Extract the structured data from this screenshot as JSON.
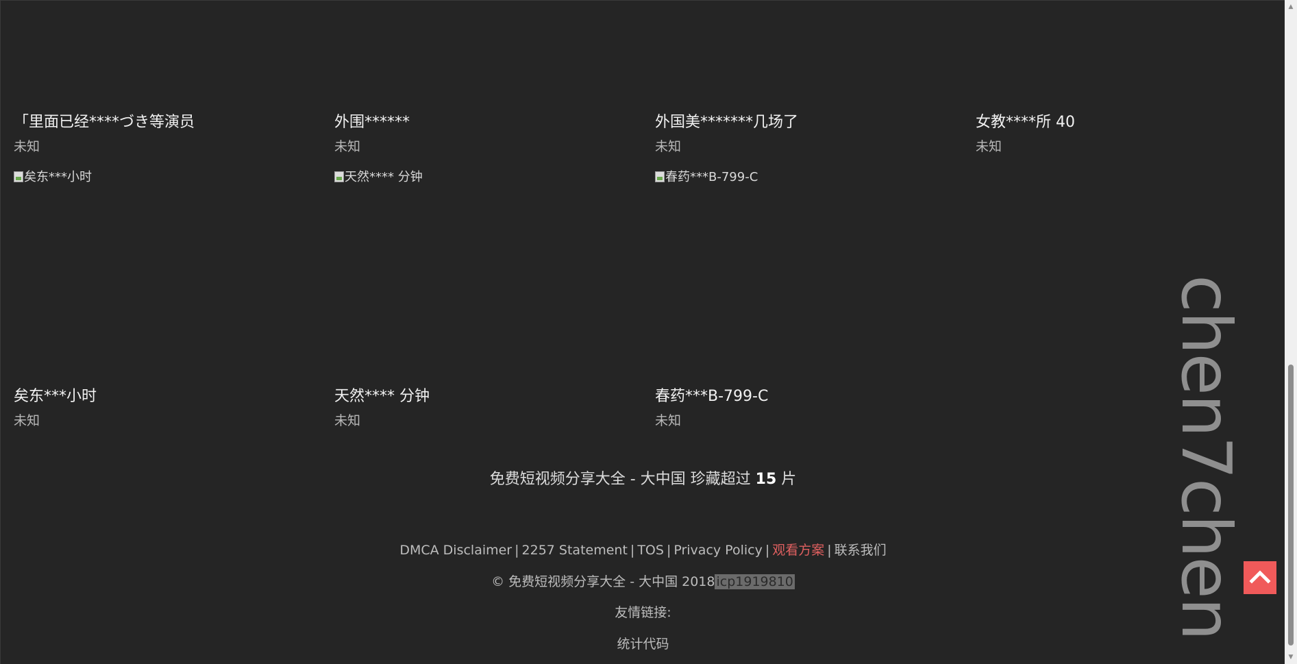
{
  "cards_row1": [
    {
      "title": "「里面已经****づき等演员",
      "sub": "未知"
    },
    {
      "title": "外围******",
      "sub": "未知"
    },
    {
      "title": "外国美*******几场了",
      "sub": "未知"
    },
    {
      "title": "女教****所 40",
      "sub": "未知"
    }
  ],
  "thumbs": [
    {
      "alt": "矣东***小时"
    },
    {
      "alt": "天然**** 分钟"
    },
    {
      "alt": "春药***B-799-C"
    }
  ],
  "cards_row2": [
    {
      "title": "矣东***小时",
      "sub": "未知"
    },
    {
      "title": "天然**** 分钟",
      "sub": "未知"
    },
    {
      "title": "春药***B-799-C",
      "sub": "未知"
    }
  ],
  "footer": {
    "tagline_prefix": "免费短视频分享大全 - 大中国 珍藏超过 ",
    "tagline_count": "15",
    "tagline_suffix": " 片",
    "links": [
      "DMCA Disclaimer",
      "2257 Statement",
      "TOS",
      "Privacy Policy",
      "观看方案",
      "联系我们"
    ],
    "separator": "|",
    "copyright_text": "© 免费短视频分享大全 - 大中国 2018",
    "icp": "icp1919810",
    "friends_label": "友情链接:",
    "stats_label": "统计代码"
  },
  "watermark": "chen7chen",
  "colors": {
    "background": "#252525",
    "accent": "#f05a5a",
    "accent_link": "#e06060"
  },
  "icons": {
    "back_to_top": "chevron-up-icon"
  }
}
